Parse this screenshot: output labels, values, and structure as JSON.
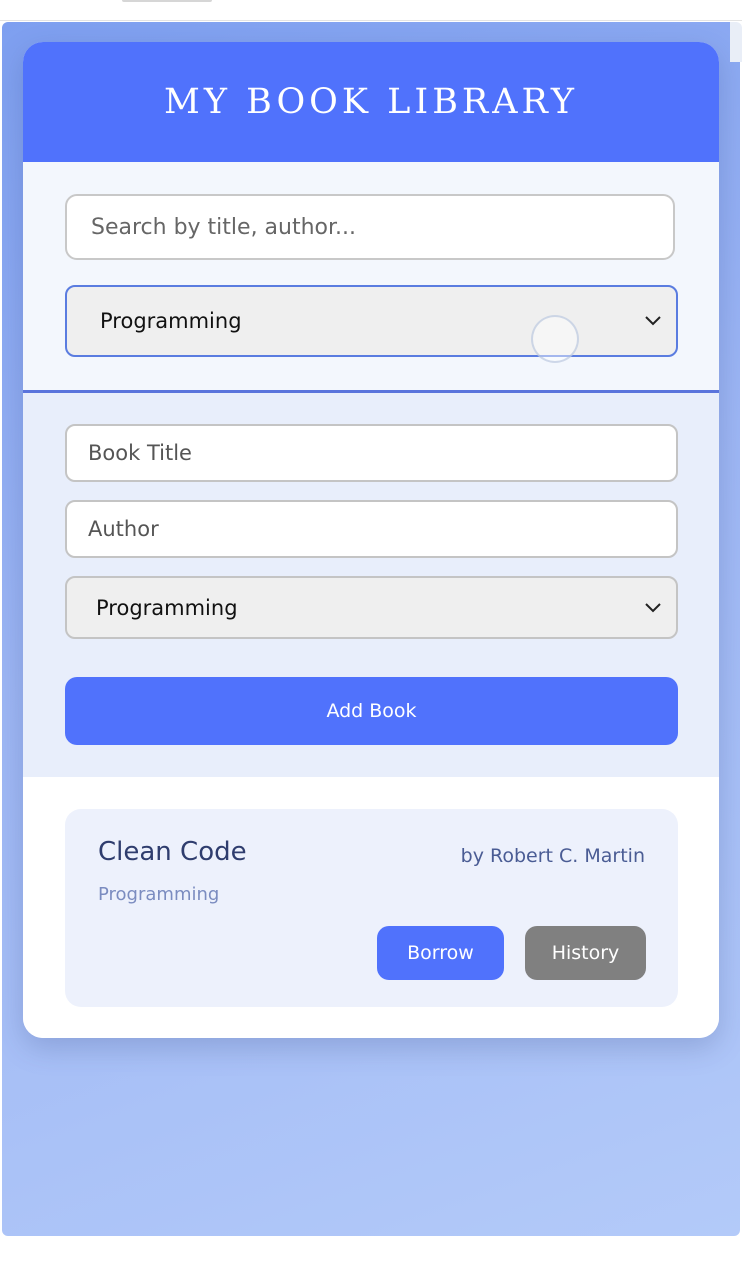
{
  "library": {
    "title": "MY BOOK LIBRARY"
  },
  "search": {
    "placeholder": "Search by title, author...",
    "value": "",
    "filter_selected": "Programming"
  },
  "add_form": {
    "title_placeholder": "Book Title",
    "author_placeholder": "Author",
    "category_selected": "Programming",
    "submit_label": "Add Book"
  },
  "books": [
    {
      "title": "Clean Code",
      "author": "by Robert C. Martin",
      "category": "Programming",
      "borrow_label": "Borrow",
      "history_label": "History"
    }
  ],
  "icons": {
    "select_arrow": "chevron-down-icon"
  },
  "colors": {
    "accent": "#5072fc",
    "history_button": "#808080",
    "background_gradient_start": "#7e9ff0",
    "background_gradient_end": "#b3caf9"
  }
}
